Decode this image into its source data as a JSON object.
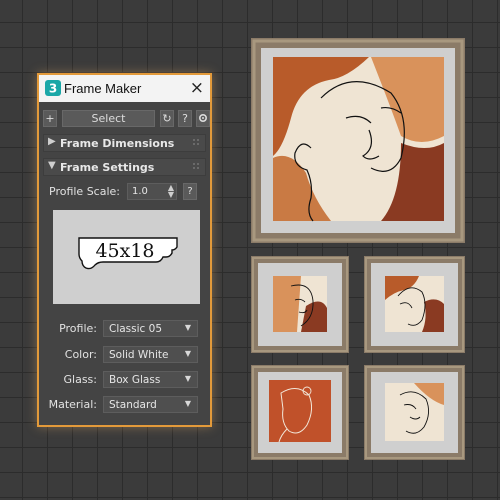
{
  "window": {
    "title": "Frame Maker",
    "close_icon": "×",
    "app_icon": "3ds-max-logo-icon",
    "accent": "#e39a3a"
  },
  "toolbar": {
    "add_label": "+",
    "select_label": "Select",
    "refresh_icon": "↻",
    "help_label": "?",
    "settings_icon": "gear-icon"
  },
  "rollouts": {
    "dimensions": {
      "arrow": "▶",
      "title": "Frame Dimensions"
    },
    "settings": {
      "arrow": "▼",
      "title": "Frame Settings"
    }
  },
  "profile_scale": {
    "label": "Profile Scale:",
    "value": "1.0",
    "help": "?"
  },
  "preview": {
    "profile_text": "45x18"
  },
  "fields": [
    {
      "label": "Profile:",
      "value": "Classic 05"
    },
    {
      "label": "Color:",
      "value": "Solid White"
    },
    {
      "label": "Glass:",
      "value": "Box Glass"
    },
    {
      "label": "Material:",
      "value": "Standard"
    }
  ],
  "gallery": {
    "frame_color": "#8b7b68",
    "mat_color": "#cfcfcf",
    "art_colors": [
      "#b85b2a",
      "#d9925b",
      "#efe4d3",
      "#8a3a22",
      "#c97a44"
    ]
  }
}
